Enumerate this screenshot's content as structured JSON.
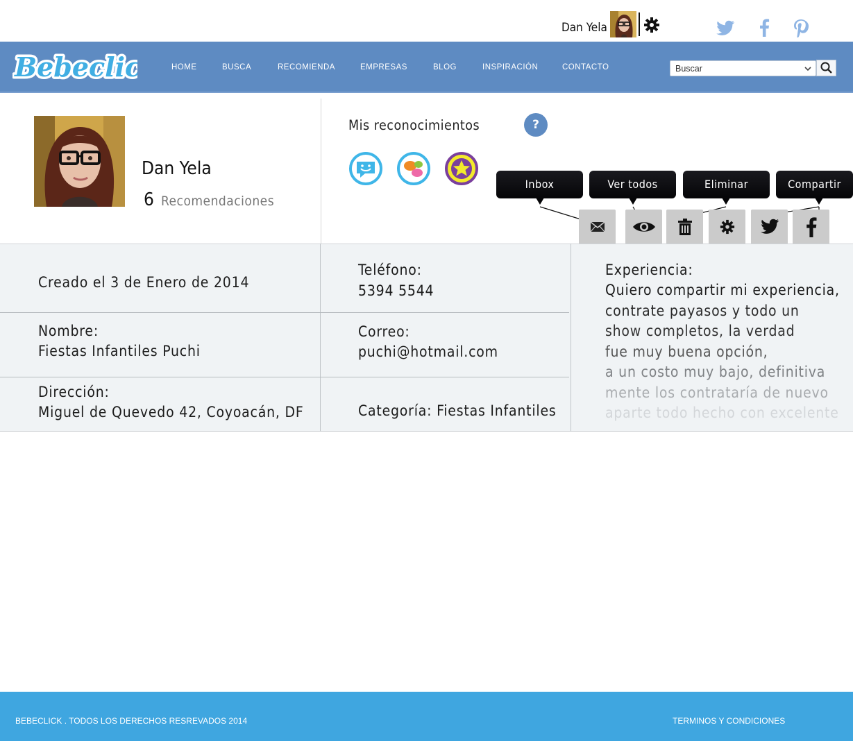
{
  "brand": {
    "logo_text": "Bebeclick",
    "accent": "#5e8bc2",
    "footer_color": "#3fa6e0"
  },
  "topbar": {
    "user_name": "Dan Yela",
    "icons": [
      "avatar",
      "gear-icon",
      "twitter-icon",
      "facebook-icon",
      "pinterest-icon"
    ]
  },
  "nav": {
    "items": [
      "HOME",
      "BUSCA",
      "RECOMIENDA",
      "EMPRESAS",
      "BLOG",
      "INSPIRACIÓN",
      "CONTACTO"
    ],
    "search_value": "Buscar"
  },
  "profile": {
    "name": "Dan Yela",
    "recommendations_count": "6",
    "recommendations_label": "Recomendaciones",
    "recognitions_title": "Mis reconocimientos",
    "help_label": "?",
    "badges": [
      {
        "icon": "smiley-message-icon",
        "color": "#3fb6e8"
      },
      {
        "icon": "chat-bubbles-icon",
        "color": "#3fb6e8"
      },
      {
        "icon": "star-icon",
        "color": "#7a3f9d"
      }
    ]
  },
  "tooltips": {
    "inbox": "Inbox",
    "ver_todos": "Ver todos",
    "eliminar": "Eliminar",
    "compartir": "Compartir"
  },
  "actions": [
    "mail-icon",
    "eye-icon",
    "trash-icon",
    "gear-icon",
    "twitter-icon",
    "facebook-icon"
  ],
  "details": {
    "created": "Creado el 3 de Enero de 2014",
    "nombre_label": "Nombre:",
    "nombre_value": "Fiestas Infantiles Puchi",
    "direccion_label": "Dirección:",
    "direccion_value": "Miguel de Quevedo 42, Coyoacán, DF",
    "telefono_label": "Teléfono:",
    "telefono_value": "5394 5544",
    "correo_label": "Correo:",
    "correo_value": "puchi@hotmail.com",
    "categoria": "Categoría: Fiestas Infantiles",
    "experiencia_label": "Experiencia:",
    "experiencia_lines": [
      "Quiero compartir mi experiencia,",
      "contrate payasos y todo un",
      "show completos, la verdad",
      "fue muy buena opción,",
      "a un costo muy bajo, definitiva",
      "mente los contrataría de nuevo",
      "aparte todo hecho con excelente"
    ]
  },
  "footer": {
    "copyright": "BEBECLICK . TODOS LOS DERECHOS RESREVADOS 2014",
    "terms": "TERMINOS Y CONDICIONES"
  }
}
